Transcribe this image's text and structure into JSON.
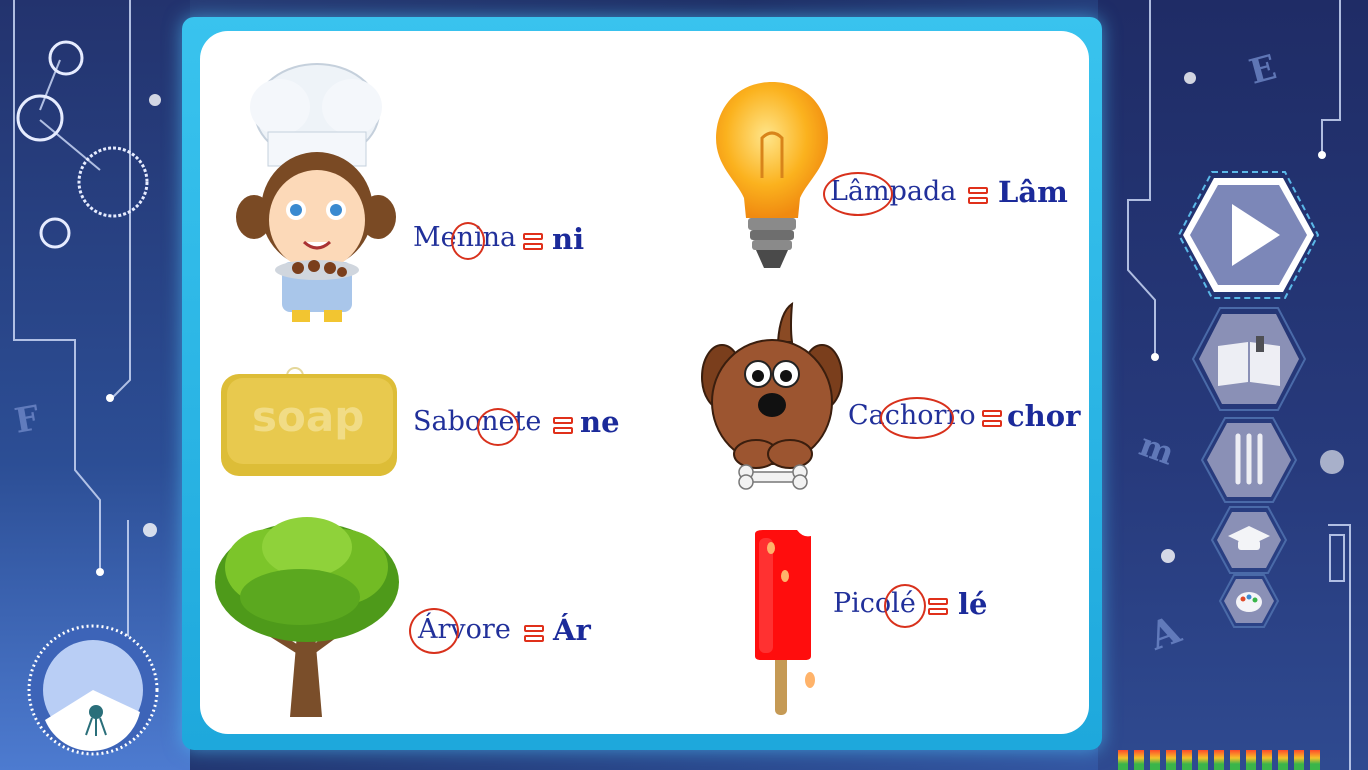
{
  "words": [
    {
      "word": "Menina",
      "syllable": "ni",
      "image": "chef-girl-image"
    },
    {
      "word": "Sabonete",
      "syllable": "ne",
      "image": "soap-bar-image",
      "soap_label": "soap"
    },
    {
      "word": "Árvore",
      "syllable": "Ár",
      "image": "tree-image"
    },
    {
      "word": "Lâmpada",
      "syllable": "Lâm",
      "image": "light-bulb-image"
    },
    {
      "word": "Cachorro",
      "syllable": "chor",
      "image": "dog-image"
    },
    {
      "word": "Picolé",
      "syllable": "lé",
      "image": "popsicle-image"
    }
  ],
  "side_letters": [
    "E",
    "F",
    "m",
    "A"
  ],
  "nav": [
    {
      "name": "play-button",
      "icon": "play-icon"
    },
    {
      "name": "book-button",
      "icon": "open-book-icon"
    },
    {
      "name": "tools-button",
      "icon": "tools-icon"
    },
    {
      "name": "graduation-button",
      "icon": "graduation-cap-icon"
    },
    {
      "name": "palette-button",
      "icon": "palette-icon"
    }
  ],
  "colors": {
    "accent_red": "#e0301a",
    "word_blue": "#21309a",
    "frame_cyan": "#2ab4e4"
  }
}
